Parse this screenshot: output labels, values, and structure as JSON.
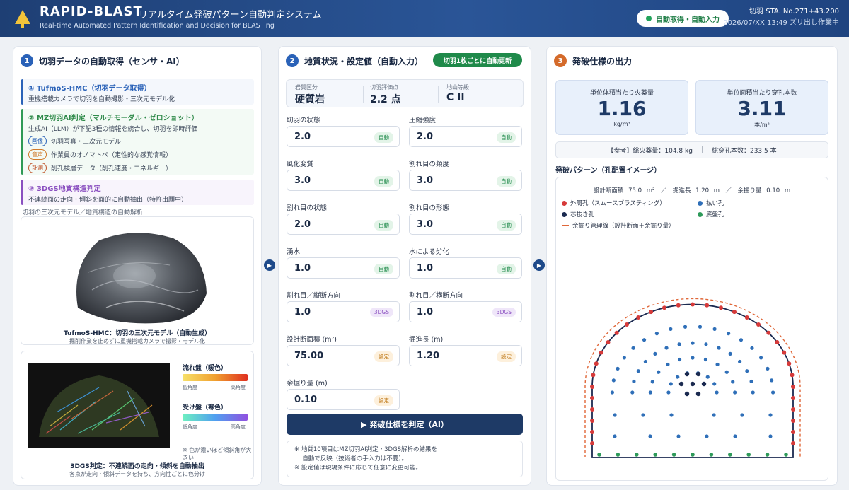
{
  "header": {
    "title": "RAPID-BLAST",
    "subtitle": "リアルタイム発破パターン自動判定システム",
    "subtitle_en": "Real-time Automated Pattern Identification and Decision for BLASTing",
    "auto_badge": "自動取得・自動入力",
    "station": "切羽 STA. No.271+43.200",
    "datetime_status": "2026/07/XX 13:49 ズリ出し作業中"
  },
  "panel1": {
    "number": "1",
    "title": "切羽データの自動取得（センサ・AI）",
    "block1": {
      "title": "① TufmoS-HMC（切羽データ取得）",
      "desc": "重機搭載カメラで切羽を自動撮影・三次元モデル化"
    },
    "block2": {
      "title": "② MZ切羽AI判定（マルチモーダル・ゼロショット）",
      "desc": "生成AI（LLM）が下記3種の情報を統合し、切羽を即時評価",
      "items": [
        {
          "tag": "画像",
          "text": "切羽写真・三次元モデル"
        },
        {
          "tag": "音声",
          "text": "作業員のオノマトペ（定性的な感覚情報）"
        },
        {
          "tag": "計測",
          "text": "削孔検層データ（削孔速度・エネルギー）"
        }
      ]
    },
    "block3": {
      "title": "③ 3DGS地質構造判定",
      "desc": "不連続面の走向・傾斜を面的に自動抽出（特許出願中）"
    },
    "section_caption": "切羽の三次元モデル／地質構造の自動解析",
    "model_caption": "TufmoS-HMC：切羽の三次元モデル（自動生成）",
    "model_note": "掘削作業を止めずに重機搭載カメラで撮影・モデル化",
    "legend": {
      "flow_title": "流れ盤（暖色）",
      "flow_low": "低角度",
      "flow_high": "高角度",
      "receive_title": "受け盤（寒色）",
      "receive_low": "低角度",
      "receive_high": "高角度",
      "note": "※ 色が濃いほど傾斜角が大きい"
    },
    "gs_caption": "3DGS判定：不連続面の走向・傾斜を自動抽出",
    "gs_note": "各点が走向・傾斜データを持ち、方向性ごとに色分け"
  },
  "panel2": {
    "number": "2",
    "title": "地質状況・設定値（自動入力）",
    "update_badge": "切羽1枚ごとに自動更新",
    "summary": {
      "rock_label": "岩質区分",
      "rock_value": "硬質岩",
      "score_label": "切羽評価点",
      "score_value": "2.2 点",
      "grade_label": "地山等級",
      "grade_value": "C II"
    },
    "fields": [
      {
        "label": "切羽の状態",
        "value": "2.0",
        "badge": "自動"
      },
      {
        "label": "圧縮強度",
        "value": "2.0",
        "badge": "自動"
      },
      {
        "label": "風化変質",
        "value": "3.0",
        "badge": "自動"
      },
      {
        "label": "割れ目の頻度",
        "value": "3.0",
        "badge": "自動"
      },
      {
        "label": "割れ目の状態",
        "value": "2.0",
        "badge": "自動"
      },
      {
        "label": "割れ目の形態",
        "value": "3.0",
        "badge": "自動"
      },
      {
        "label": "湧水",
        "value": "1.0",
        "badge": "自動"
      },
      {
        "label": "水による劣化",
        "value": "1.0",
        "badge": "自動"
      },
      {
        "label": "割れ目／縦断方向",
        "value": "1.0",
        "badge": "3DGS"
      },
      {
        "label": "割れ目／横断方向",
        "value": "1.0",
        "badge": "3DGS"
      },
      {
        "label": "設計断面積 (m²)",
        "value": "75.00",
        "badge": "設定"
      },
      {
        "label": "掘進長 (m)",
        "value": "1.20",
        "badge": "設定"
      },
      {
        "label": "余掘り量 (m)",
        "value": "0.10",
        "badge": "設定"
      }
    ],
    "judge_button": "▶ 発破仕様を判定（AI）",
    "note1": "※ 地質10項目はMZ切羽AI判定・3DGS解析の結果を",
    "note2": "　 自動で反映（技術者の手入力は不要）。",
    "note3": "※ 設定値は現場条件に応じて任意に変更可能。"
  },
  "panel3": {
    "number": "3",
    "title": "発破仕様の出力",
    "card1": {
      "label": "単位体積当たり火薬量",
      "value": "1.16",
      "unit": "kg/m³"
    },
    "card2": {
      "label": "単位面積当たり穿孔本数",
      "value": "3.11",
      "unit": "本/m²"
    },
    "ref_total": "【参考】総火薬量：104.8 kg",
    "ref_sep": "|",
    "ref_holes": "総穿孔本数：233.5 本",
    "pattern_title": "発破パターン（孔配置イメージ）",
    "dims": "設計断面積 75.0 m²　／　掘進長 1.20 m　／　余掘り量 0.10 m",
    "legend": {
      "perimeter": "外周孔（スムースブラスティング）",
      "relief": "払い孔",
      "cut": "芯抜き孔",
      "floor": "底盤孔",
      "overbreak": "余掘り管理線（設計断面＋余掘り量）"
    },
    "colors": {
      "perimeter": "#d63a3a",
      "relief": "#2f6fb8",
      "cut": "#1b2a50",
      "floor": "#2e9a5a"
    }
  }
}
